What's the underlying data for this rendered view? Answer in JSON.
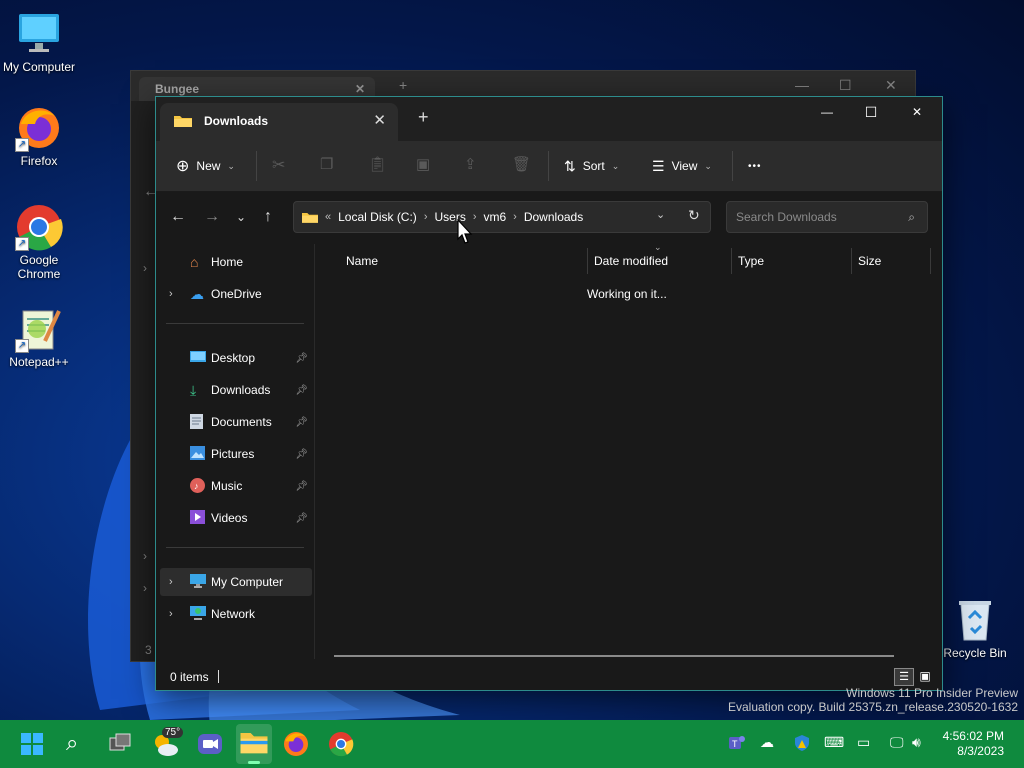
{
  "desktop": {
    "icons": [
      {
        "label": "My Computer"
      },
      {
        "label": "Firefox"
      },
      {
        "label": "Google Chrome"
      },
      {
        "label": "Notepad++"
      },
      {
        "label": "Recycle Bin"
      }
    ],
    "watermark": {
      "line1": "Windows 11 Pro Insider Preview",
      "line2": "Evaluation copy. Build 25375.zn_release.230520-1632"
    }
  },
  "background_window": {
    "tab_title": "Bungee",
    "sidebar_fragments": {
      "count_char": "3"
    }
  },
  "explorer": {
    "tab_title": "Downloads",
    "new_tab_glyph": "+",
    "window_controls": {
      "minimize": "—",
      "maximize": "☐",
      "close": "✕"
    },
    "toolbar": {
      "new_label": "New",
      "sort_label": "Sort",
      "view_label": "View",
      "more_glyph": "•••"
    },
    "address": {
      "overflow": "«",
      "crumbs": [
        "Local Disk (C:)",
        "Users",
        "vm6",
        "Downloads"
      ]
    },
    "search": {
      "placeholder": "Search Downloads"
    },
    "sidebar": {
      "home": "Home",
      "onedrive": "OneDrive",
      "pinned": [
        "Desktop",
        "Downloads",
        "Documents",
        "Pictures",
        "Music",
        "Videos"
      ],
      "my_computer": "My Computer",
      "network": "Network"
    },
    "columns": [
      "Name",
      "Date modified",
      "Type",
      "Size"
    ],
    "loading_text": "Working on it...",
    "status": {
      "items": "0 items"
    }
  },
  "taskbar": {
    "weather_badge": "75°",
    "clock": {
      "time": "4:56:02 PM",
      "date": "8/3/2023"
    }
  },
  "colors": {
    "taskbar": "#0f8a3e",
    "window_border": "#2d8c8c",
    "folder": "#f4c542"
  }
}
